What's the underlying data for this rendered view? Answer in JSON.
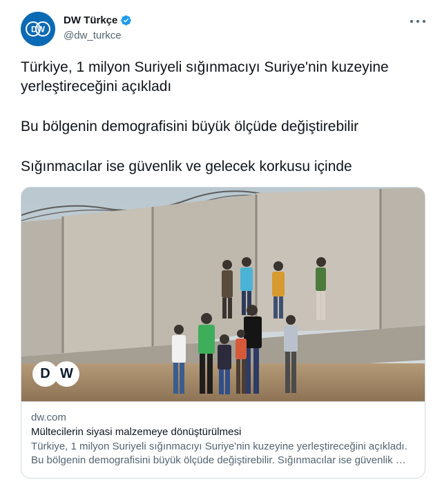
{
  "author": {
    "name": "DW Türkçe",
    "handle": "@dw_turkce",
    "avatar_text": "DW",
    "verified_icon": "verified-badge-icon",
    "brand_color": "#0b6ab4"
  },
  "menu": {
    "icon": "more-options-icon"
  },
  "tweet": {
    "paragraphs": [
      "Türkiye, 1 milyon Suriyeli sığınmacıyı Suriye'nin kuzeyine yerleştireceğini açıkladı",
      "Bu bölgenin demografisini büyük ölçüde değiştirebilir",
      "Sığınmacılar ise güvenlik ve gelecek korkusu içinde"
    ]
  },
  "card": {
    "image_watermark": {
      "left": "D",
      "right": "W"
    },
    "domain": "dw.com",
    "title": "Mültecilerin siyasi malzemeye dönüştürülmesi",
    "description": "Türkiye, 1 milyon Suriyeli sığınmacıyı Suriye'nin kuzeyine yerleştireceğini açıkladı. Bu bölgenin demografisini büyük ölçüde değiştirebilir. Sığınmacılar ise güvenlik …"
  }
}
